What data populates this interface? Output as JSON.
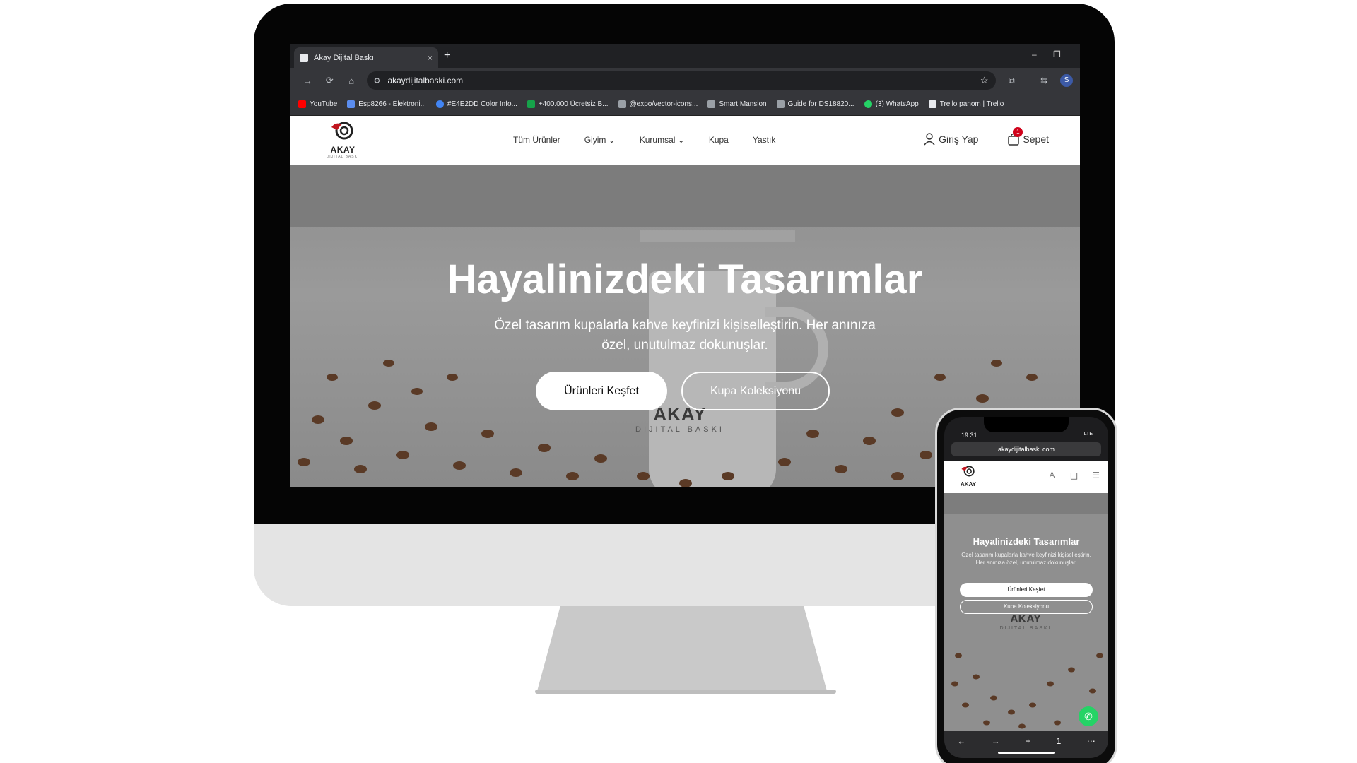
{
  "browser": {
    "tab_title": "Akay Dijital Baskı",
    "tab_close": "×",
    "new_tab": "+",
    "minimize": "–",
    "restore": "❐",
    "url": "akaydijitalbaski.com",
    "back": "←",
    "forward": "→",
    "reload": "⟳",
    "home": "⌂",
    "site_info": "⚙",
    "star": "☆",
    "extensions": "⧉",
    "translate": "⇆",
    "profile": "S",
    "bookmarks": [
      {
        "label": "YouTube",
        "color": "#ff0000"
      },
      {
        "label": "Esp8266 - Elektroni...",
        "color": "#5b8def"
      },
      {
        "label": "#E4E2DD Color Info...",
        "color": "#4285f4"
      },
      {
        "label": "+400.000 Ücretsiz B...",
        "color": "#16a34a"
      },
      {
        "label": "@expo/vector-icons...",
        "color": "#9aa0a6"
      },
      {
        "label": "Smart Mansion",
        "color": "#9aa0a6"
      },
      {
        "label": "Guide for DS18820...",
        "color": "#9aa0a6"
      },
      {
        "label": "(3) WhatsApp",
        "color": "#25d366"
      },
      {
        "label": "Trello panom | Trello",
        "color": "#e8eaed"
      }
    ]
  },
  "site": {
    "logo_text": "AKAY",
    "logo_sub": "DIJITAL BASKI",
    "nav": [
      "Tüm Ürünler",
      "Giyim ⌄",
      "Kurumsal ⌄",
      "Kupa",
      "Yastık"
    ],
    "login": "Giriş Yap",
    "cart": "Sepet",
    "cart_count": "1",
    "hero_title": "Hayalinizdeki Tasarımlar",
    "hero_subtitle": "Özel tasarım kupalarla kahve keyfinizi kişiselleştirin. Her anınıza özel, unutulmaz dokunuşlar.",
    "btn_primary": "Ürünleri Keşfet",
    "btn_secondary": "Kupa Koleksiyonu",
    "watermark_title": "AKAY",
    "watermark_sub": "DIJITAL BASKI"
  },
  "phone": {
    "time": "19:31",
    "signal": "LTE",
    "url": "akaydijitalbaski.com",
    "icons": [
      "♙",
      "◫",
      "☰"
    ],
    "toolbar": [
      "←",
      "→",
      "+",
      "1",
      "⋯"
    ],
    "whatsapp": "✆"
  },
  "colors": {
    "accent_red": "#d0021b",
    "whatsapp_green": "#25d366"
  }
}
